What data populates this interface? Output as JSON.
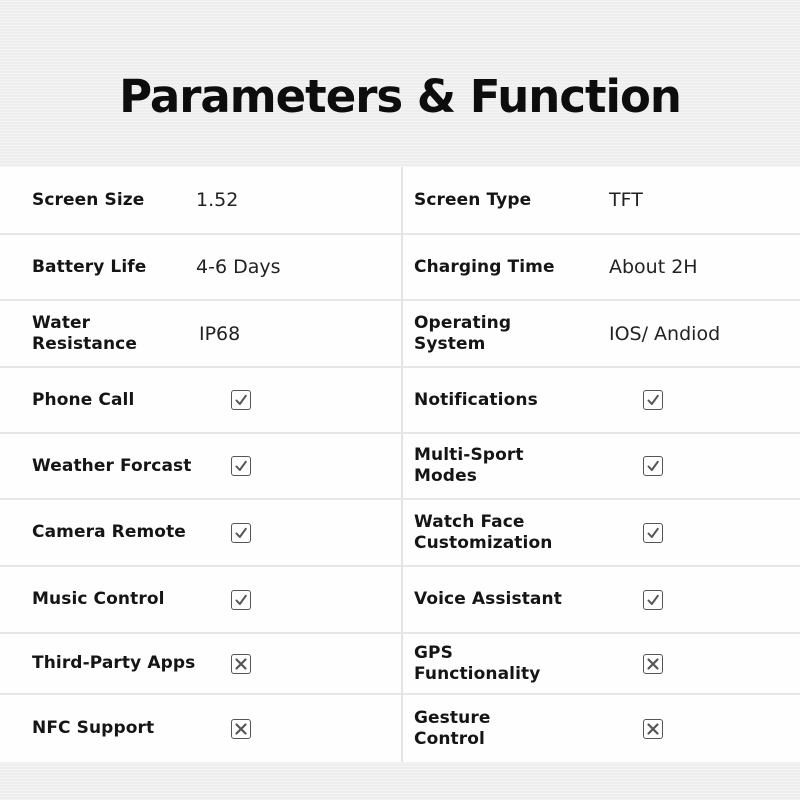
{
  "title": "Parameters & Function",
  "specs": [
    {
      "left": {
        "label": "Screen Size",
        "value": "1.52"
      },
      "right": {
        "label": "Screen Type",
        "value": "TFT"
      }
    },
    {
      "left": {
        "label": "Battery Life",
        "value": "4-6 Days"
      },
      "right": {
        "label": "Charging Time",
        "value": "About 2H"
      }
    },
    {
      "left": {
        "label": "Water Resistance",
        "value": "IP68"
      },
      "right": {
        "label": "Operating System",
        "value": "IOS/ Andiod"
      }
    }
  ],
  "functions": [
    {
      "left": {
        "label": "Phone Call",
        "supported": true,
        "icon": "checkbox-checked-icon"
      },
      "right": {
        "label": "Notifications",
        "supported": true,
        "icon": "checkbox-checked-icon"
      }
    },
    {
      "left": {
        "label": "Weather Forcast",
        "supported": true,
        "icon": "checkbox-checked-icon"
      },
      "right": {
        "label": "Multi-Sport Modes",
        "supported": true,
        "icon": "checkbox-checked-icon"
      }
    },
    {
      "left": {
        "label": "Camera Remote",
        "supported": true,
        "icon": "checkbox-checked-icon"
      },
      "right": {
        "label": "Watch Face Customization",
        "supported": true,
        "icon": "checkbox-checked-icon"
      }
    },
    {
      "left": {
        "label": "Music Control",
        "supported": true,
        "icon": "checkbox-checked-icon"
      },
      "right": {
        "label": "Voice Assistant",
        "supported": true,
        "icon": "checkbox-checked-icon"
      }
    },
    {
      "left": {
        "label": "Third-Party Apps",
        "supported": false,
        "icon": "checkbox-crossed-icon"
      },
      "right": {
        "label": "GPS Functionality",
        "supported": false,
        "icon": "checkbox-crossed-icon"
      }
    },
    {
      "left": {
        "label": "NFC Support",
        "supported": false,
        "icon": "checkbox-crossed-icon"
      },
      "right": {
        "label": "Gesture Control",
        "supported": false,
        "icon": "checkbox-crossed-icon"
      }
    }
  ],
  "colors": {
    "background": "#eeeeee",
    "table": "#fefefe",
    "divider": "#e6e6e6",
    "icon": "#555555",
    "text": "#151515"
  }
}
